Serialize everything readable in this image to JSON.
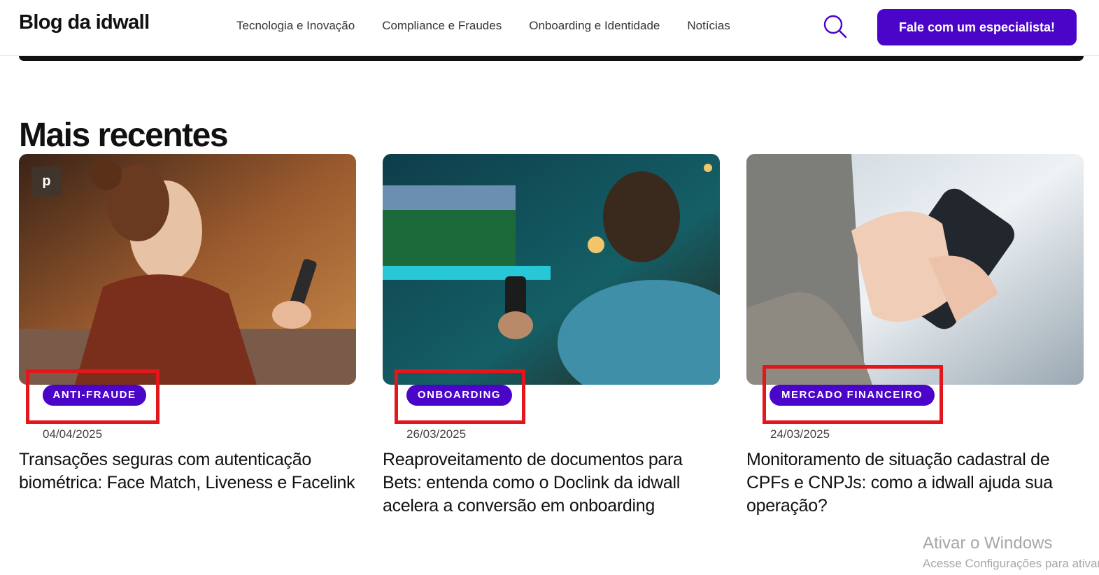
{
  "header": {
    "logo": "Blog da idwall",
    "nav": [
      "Tecnologia e Inovação",
      "Compliance e Fraudes",
      "Onboarding e Identidade",
      "Notícias"
    ],
    "cta_label": "Fale com um especialista!"
  },
  "section": {
    "title": "Mais recentes"
  },
  "cards": [
    {
      "tag": "ANTI-FRAUDE",
      "date": "04/04/2025",
      "title": "Transações seguras com autenticação biométrica: Face Match, Liveness e Facelink",
      "pin_icon": "p"
    },
    {
      "tag": "ONBOARDING",
      "date": "26/03/2025",
      "title": "Reaproveitamento de documentos para Bets: entenda como o Doclink da idwall acelera a conversão em onboarding"
    },
    {
      "tag": "MERCADO FINANCEIRO",
      "date": "24/03/2025",
      "title": "Monitoramento de situação cadastral de CPFs e CNPJs: como a idwall ajuda sua operação?"
    }
  ],
  "watermark": {
    "line1": "Ativar o Windows",
    "line2": "Acesse Configurações para ativar"
  },
  "colors": {
    "brand": "#4a05c9",
    "highlight": "#e3161b"
  }
}
